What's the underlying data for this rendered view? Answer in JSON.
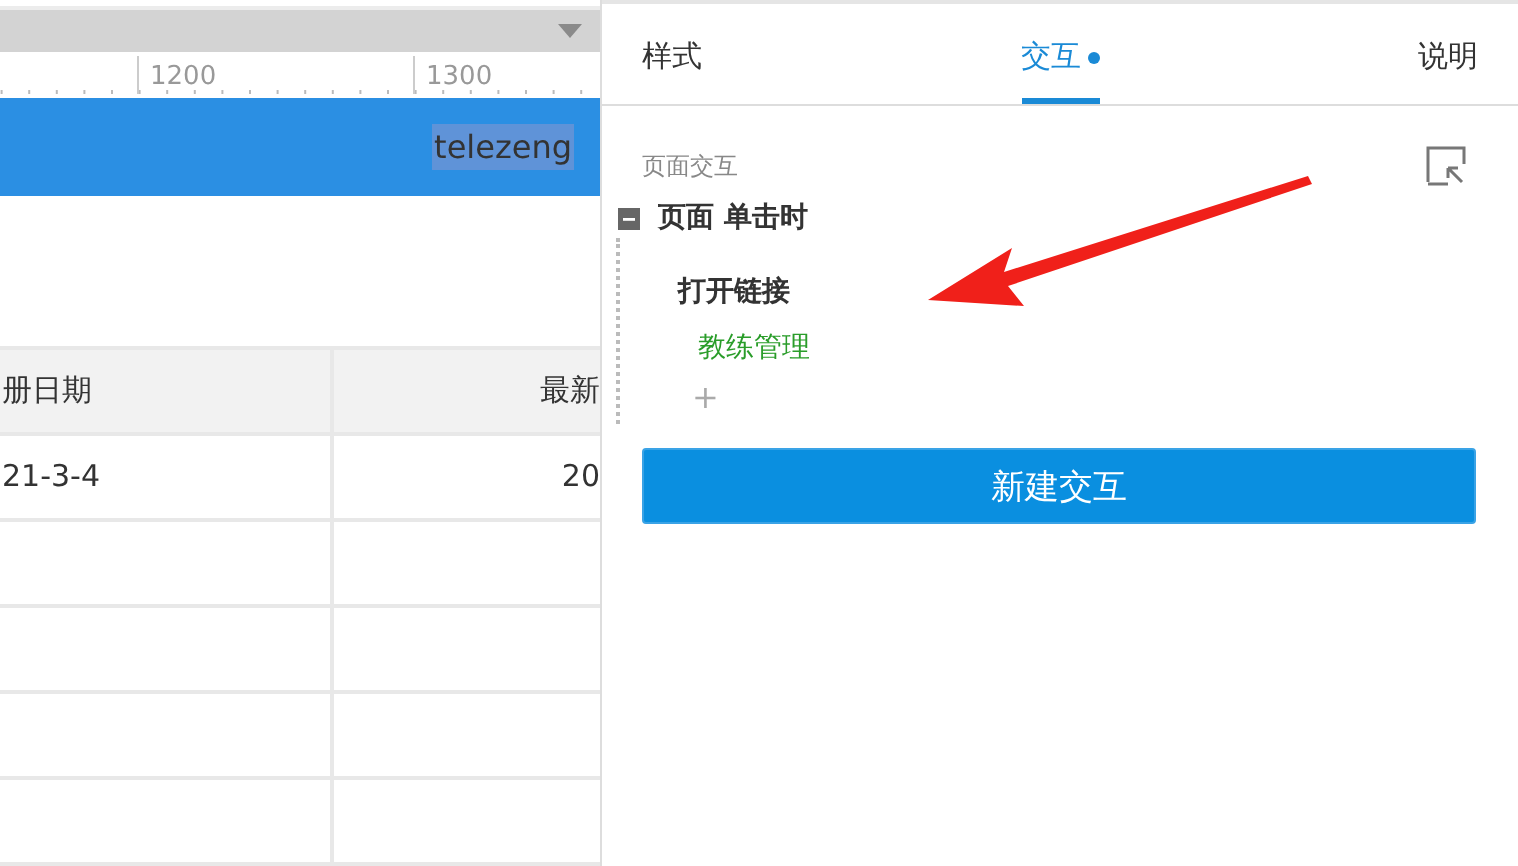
{
  "canvas": {
    "ruler": {
      "labels": [
        "1200",
        "1300"
      ]
    },
    "header": {
      "text": "telezeng",
      "selected": true
    },
    "table": {
      "columns": [
        "册日期",
        "最新"
      ],
      "rows": [
        [
          "21-3-4",
          "20"
        ]
      ]
    }
  },
  "panel": {
    "tabs": [
      {
        "label": "样式",
        "selected": false,
        "dot": false
      },
      {
        "label": "交互",
        "selected": true,
        "dot": true
      },
      {
        "label": "说明",
        "selected": false,
        "dot": false
      }
    ],
    "section_title": "页面交互",
    "event": {
      "label": "页面 单击时",
      "expanded": true,
      "actions": [
        {
          "label": "打开链接",
          "target": "教练管理"
        }
      ],
      "add": "+"
    },
    "new_button": "新建交互"
  }
}
